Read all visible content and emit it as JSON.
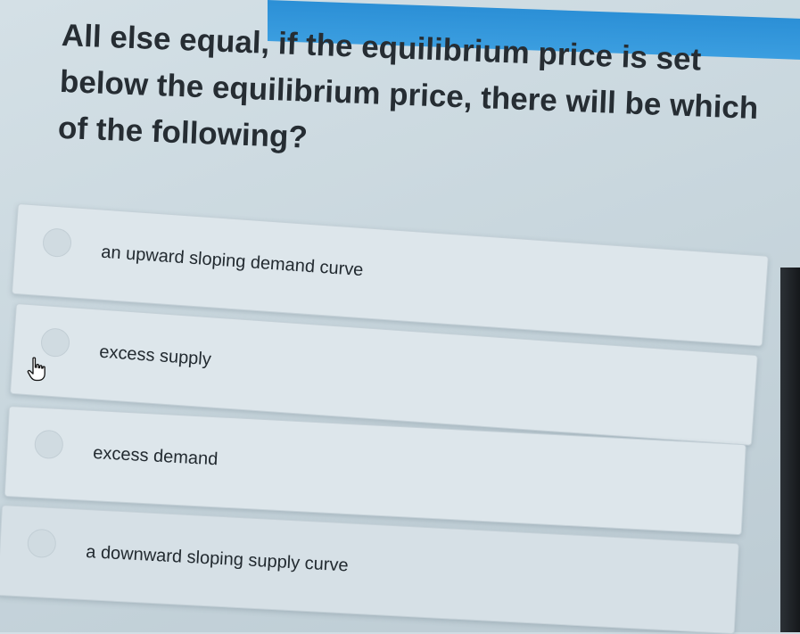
{
  "question": {
    "text": "All else equal, if the equilibrium price is set below the equilibrium price, there will be which of the following?"
  },
  "options": [
    {
      "label": "an upward sloping demand curve"
    },
    {
      "label": "excess supply"
    },
    {
      "label": "excess demand"
    },
    {
      "label": "a downward sloping supply curve"
    }
  ],
  "colors": {
    "top_bar": "#2b8fd6",
    "background": "#ccd9df",
    "option_bg": "#dde6eb",
    "text": "#262d33"
  },
  "cursor": {
    "icon": "hand-pointer-icon"
  }
}
